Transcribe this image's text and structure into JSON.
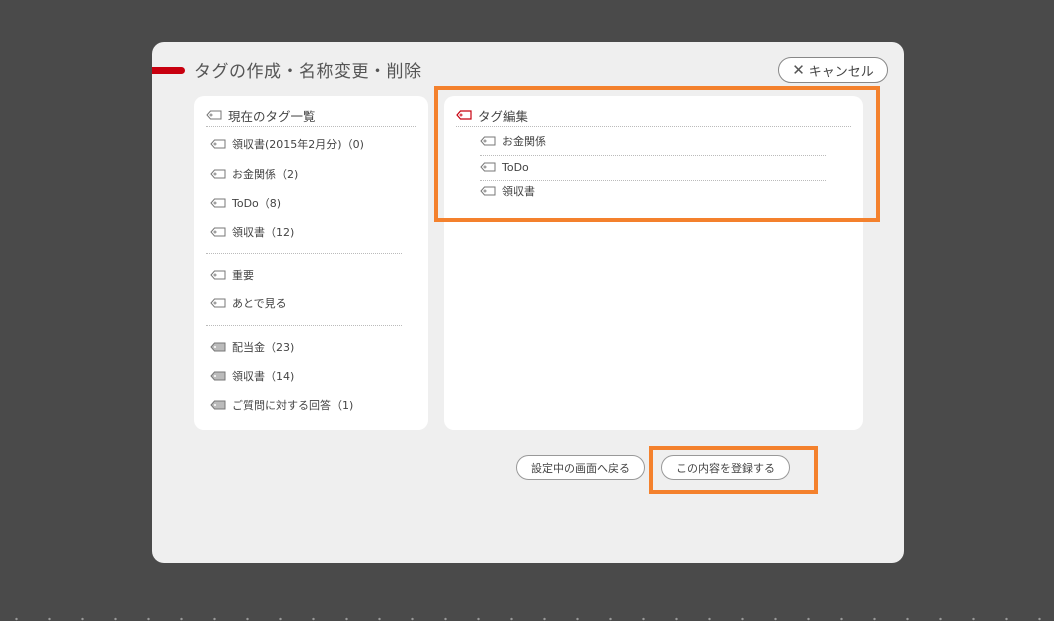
{
  "dialog": {
    "title": "タグの作成・名称変更・削除",
    "cancel_label": "キャンセル",
    "cancel_icon": "close-icon"
  },
  "current_tags": {
    "header": "現在のタグ一覧",
    "group1": [
      {
        "label": "領収書(2015年2月分)（0)"
      },
      {
        "label": "お金関係（2)"
      },
      {
        "label": "ToDo（8)"
      },
      {
        "label": "領収書（12)"
      }
    ],
    "group2": [
      {
        "label": "重要"
      },
      {
        "label": "あとで見る"
      }
    ],
    "group3": [
      {
        "label": "配当金（23)"
      },
      {
        "label": "領収書（14)"
      },
      {
        "label": "ご質問に対する回答（1)"
      }
    ]
  },
  "tag_edit": {
    "header": "タグ編集",
    "items": [
      {
        "label": "お金関係"
      },
      {
        "label": "ToDo"
      },
      {
        "label": "領収書"
      }
    ]
  },
  "buttons": {
    "back_label": "設定中の画面へ戻る",
    "register_label": "この内容を登録する"
  },
  "colors": {
    "accent_red": "#c8000f",
    "highlight_orange": "#f4812d",
    "background": "#4a4a4a",
    "dialog": "#efefef"
  }
}
